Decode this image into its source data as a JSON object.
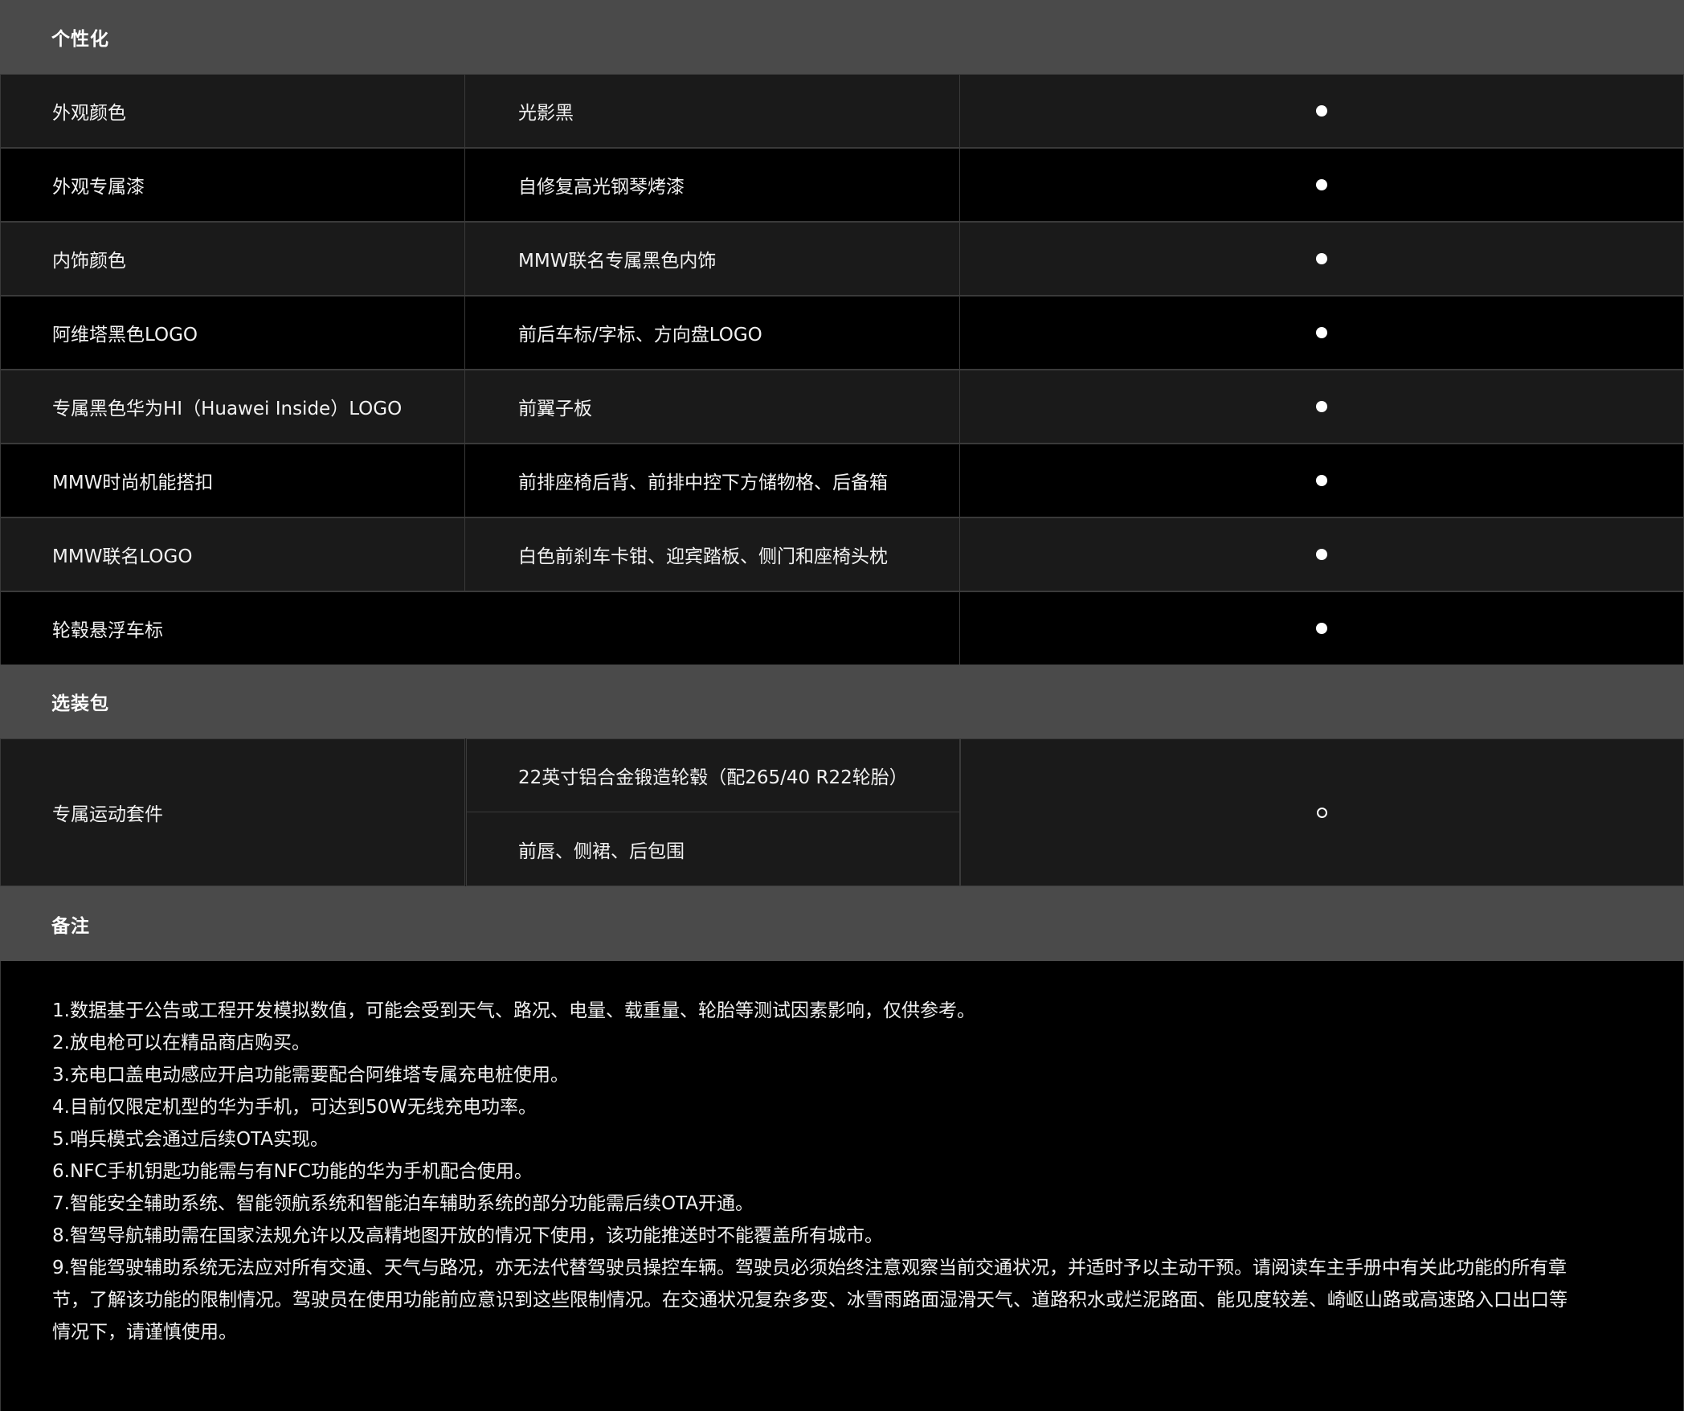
{
  "sections": {
    "personalization": "个性化",
    "options": "选装包",
    "remarks": "备注"
  },
  "personalization_rows": [
    {
      "feature": "外观颜色",
      "detail": "光影黑",
      "availability": "●"
    },
    {
      "feature": "外观专属漆",
      "detail": "自修复高光钢琴烤漆",
      "availability": "●"
    },
    {
      "feature": "内饰颜色",
      "detail": "MMW联名专属黑色内饰",
      "availability": "●"
    },
    {
      "feature": "阿维塔黑色LOGO",
      "detail": "前后车标/字标、方向盘LOGO",
      "availability": "●"
    },
    {
      "feature": "专属黑色华为HI（Huawei Inside）LOGO",
      "detail": "前翼子板",
      "availability": "●"
    },
    {
      "feature": "MMW时尚机能搭扣",
      "detail": "前排座椅后背、前排中控下方储物格、后备箱",
      "availability": "●"
    },
    {
      "feature": "MMW联名LOGO",
      "detail": "白色前刹车卡钳、迎宾踏板、侧门和座椅头枕",
      "availability": "●"
    },
    {
      "feature": "轮毂悬浮车标",
      "detail": "",
      "availability": "●"
    }
  ],
  "option_package": {
    "name": "专属运动套件",
    "items": [
      "22英寸铝合金锻造轮毂（配265/40 R22轮胎）",
      "前唇、侧裙、后包围"
    ],
    "availability": "○"
  },
  "remarks": [
    "1.数据基于公告或工程开发模拟数值，可能会受到天气、路况、电量、载重量、轮胎等测试因素影响，仅供参考。",
    "2.放电枪可以在精品商店购买。",
    "3.充电口盖电动感应开启功能需要配合阿维塔专属充电桩使用。",
    "4.目前仅限定机型的华为手机，可达到50W无线充电功率。",
    "5.哨兵模式会通过后续OTA实现。",
    "6.NFC手机钥匙功能需与有NFC功能的华为手机配合使用。",
    "7.智能安全辅助系统、智能领航系统和智能泊车辅助系统的部分功能需后续OTA开通。",
    "8.智驾导航辅助需在国家法规允许以及高精地图开放的情况下使用，该功能推送时不能覆盖所有城市。",
    "9.智能驾驶辅助系统无法应对所有交通、天气与路况，亦无法代替驾驶员操控车辆。驾驶员必须始终注意观察当前交通状况，并适时予以主动干预。请阅读车主手册中有关此功能的所有章",
    "节，了解该功能的限制情况。驾驶员在使用功能前应意识到这些限制情况。在交通状况复杂多变、冰雪雨路面湿滑天气、道路积水或烂泥路面、能见度较差、崎岖山路或高速路入口出口等",
    "情况下，请谨慎使用。"
  ],
  "colors": {
    "section_header_bg": "#4a4a4a",
    "row_light_bg": "#1a1a1a",
    "row_dark_bg": "#000000",
    "border": "#3a3a3a",
    "text": "#ffffff"
  }
}
